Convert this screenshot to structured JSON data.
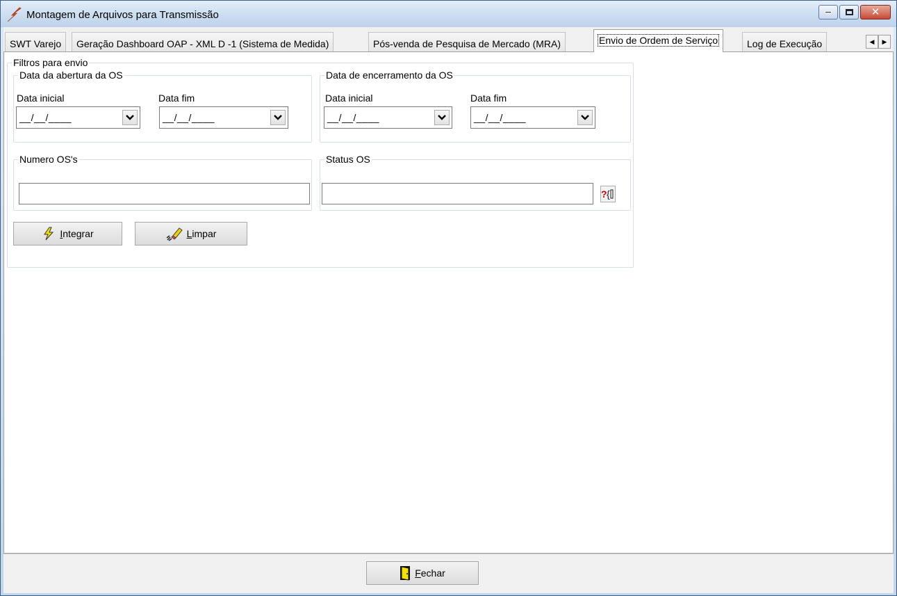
{
  "window": {
    "title": "Montagem de Arquivos para Transmissão",
    "icon": "app-bolt-icon"
  },
  "tabs": [
    {
      "label": "SWT Varejo"
    },
    {
      "label": "Geração Dashboard OAP - XML D -1 (Sistema de Medida)"
    },
    {
      "label": "Pós-venda de Pesquisa de Mercado (MRA)"
    },
    {
      "label": "Envio de Ordem de Serviço",
      "active": true
    },
    {
      "label": "Log de Execução"
    }
  ],
  "filters": {
    "group_title": "Filtros para envio",
    "abertura": {
      "title": "Data da abertura da OS",
      "start_label": "Data inicial",
      "start_value": "__/__/____",
      "end_label": "Data fim",
      "end_value": "__/__/____"
    },
    "encerramento": {
      "title": "Data de encerramento da OS",
      "start_label": "Data inicial",
      "start_value": "__/__/____",
      "end_label": "Data fim",
      "end_value": "__/__/____"
    },
    "numero_os": {
      "title": "Numero OS's",
      "value": ""
    },
    "status_os": {
      "title": "Status OS",
      "value": "",
      "lookup_icon": "lookup-icon"
    }
  },
  "buttons": {
    "integrar": {
      "prefix": "",
      "accel": "I",
      "rest": "ntegrar",
      "icon": "lightning-icon"
    },
    "limpar": {
      "prefix": "",
      "accel": "L",
      "rest": "impar",
      "icon": "eraser-icon"
    },
    "fechar": {
      "prefix": "",
      "accel": "F",
      "rest": "echar",
      "icon": "exit-door-icon"
    }
  }
}
